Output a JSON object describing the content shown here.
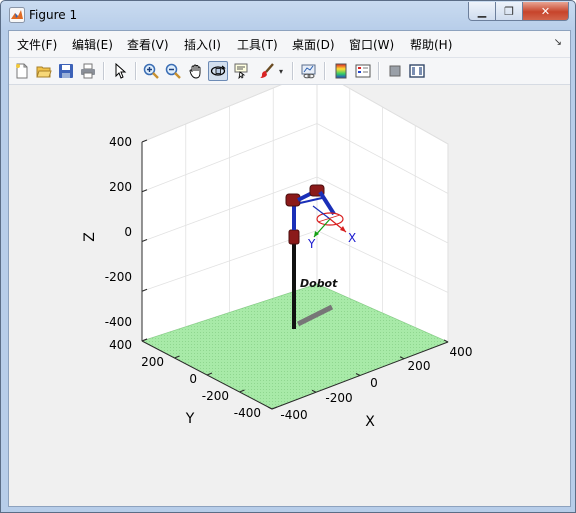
{
  "window": {
    "title": "Figure 1",
    "controls": {
      "minimize": "▁",
      "maximize": "❐",
      "close": "✕"
    }
  },
  "menubar": {
    "items": [
      "文件(F)",
      "编辑(E)",
      "查看(V)",
      "插入(I)",
      "工具(T)",
      "桌面(D)",
      "窗口(W)",
      "帮助(H)"
    ],
    "overflow_icon": "dock-arrow-icon"
  },
  "toolbar": {
    "buttons": [
      "new-figure-icon",
      "open-file-icon",
      "save-icon",
      "print-icon",
      "pointer-icon",
      "zoom-in-icon",
      "zoom-out-icon",
      "pan-icon",
      "rotate-3d-icon",
      "data-cursor-icon",
      "brush-icon",
      "brush-dropdown-icon",
      "link-plot-icon",
      "colorbar-icon",
      "legend-icon",
      "hide-plot-tools-icon",
      "show-plot-tools-icon"
    ],
    "pressed": "rotate-3d-icon"
  },
  "chart_data": {
    "type": "3d-robot-plot",
    "xlabel": "X",
    "ylabel": "Y",
    "zlabel": "Z",
    "xlim": [
      -400,
      400
    ],
    "ylim": [
      -400,
      400
    ],
    "zlim": [
      -400,
      400
    ],
    "x_ticks": [
      "-400",
      "-200",
      "0",
      "200",
      "400"
    ],
    "y_ticks": [
      "400",
      "200",
      "0",
      "-200",
      "-400"
    ],
    "z_ticks": [
      "400",
      "200",
      "0",
      "-200",
      "-400"
    ],
    "grid": true,
    "floor_color": "#9be39b",
    "robot_name": "Dobot",
    "frame_labels": {
      "x": "X",
      "y": "Y"
    },
    "colors": {
      "link": "#1a2fb8",
      "joint": "#8b1a1a",
      "frame_x": "#d81e1e",
      "frame_y": "#12a012",
      "frame_label_x": "#1a1ad0",
      "frame_label_y": "#1a1ad0"
    }
  }
}
